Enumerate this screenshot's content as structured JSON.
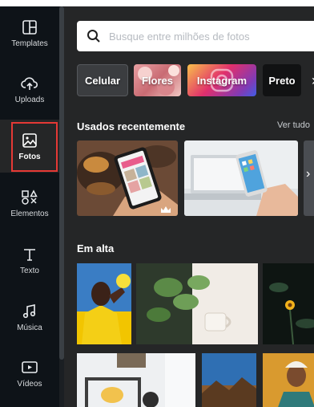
{
  "sidebar": {
    "items": [
      {
        "label": "Templates",
        "icon": "templates-icon"
      },
      {
        "label": "Uploads",
        "icon": "cloud-upload-icon"
      },
      {
        "label": "Fotos",
        "icon": "photo-icon",
        "active": true
      },
      {
        "label": "Elementos",
        "icon": "shapes-icon"
      },
      {
        "label": "Texto",
        "icon": "text-icon"
      },
      {
        "label": "Música",
        "icon": "music-icon"
      },
      {
        "label": "Vídeos",
        "icon": "video-icon"
      }
    ]
  },
  "search": {
    "placeholder": "Busque entre milhões de fotos"
  },
  "chips": [
    "Celular",
    "Flores",
    "Instagram",
    "Preto"
  ],
  "recent": {
    "title": "Usados recentemente",
    "see_all": "Ver tudo"
  },
  "trending": {
    "title": "Em alta"
  },
  "colors": {
    "sidebar": "#0e1318",
    "panel": "#252627",
    "active_outline": "#e53935"
  }
}
